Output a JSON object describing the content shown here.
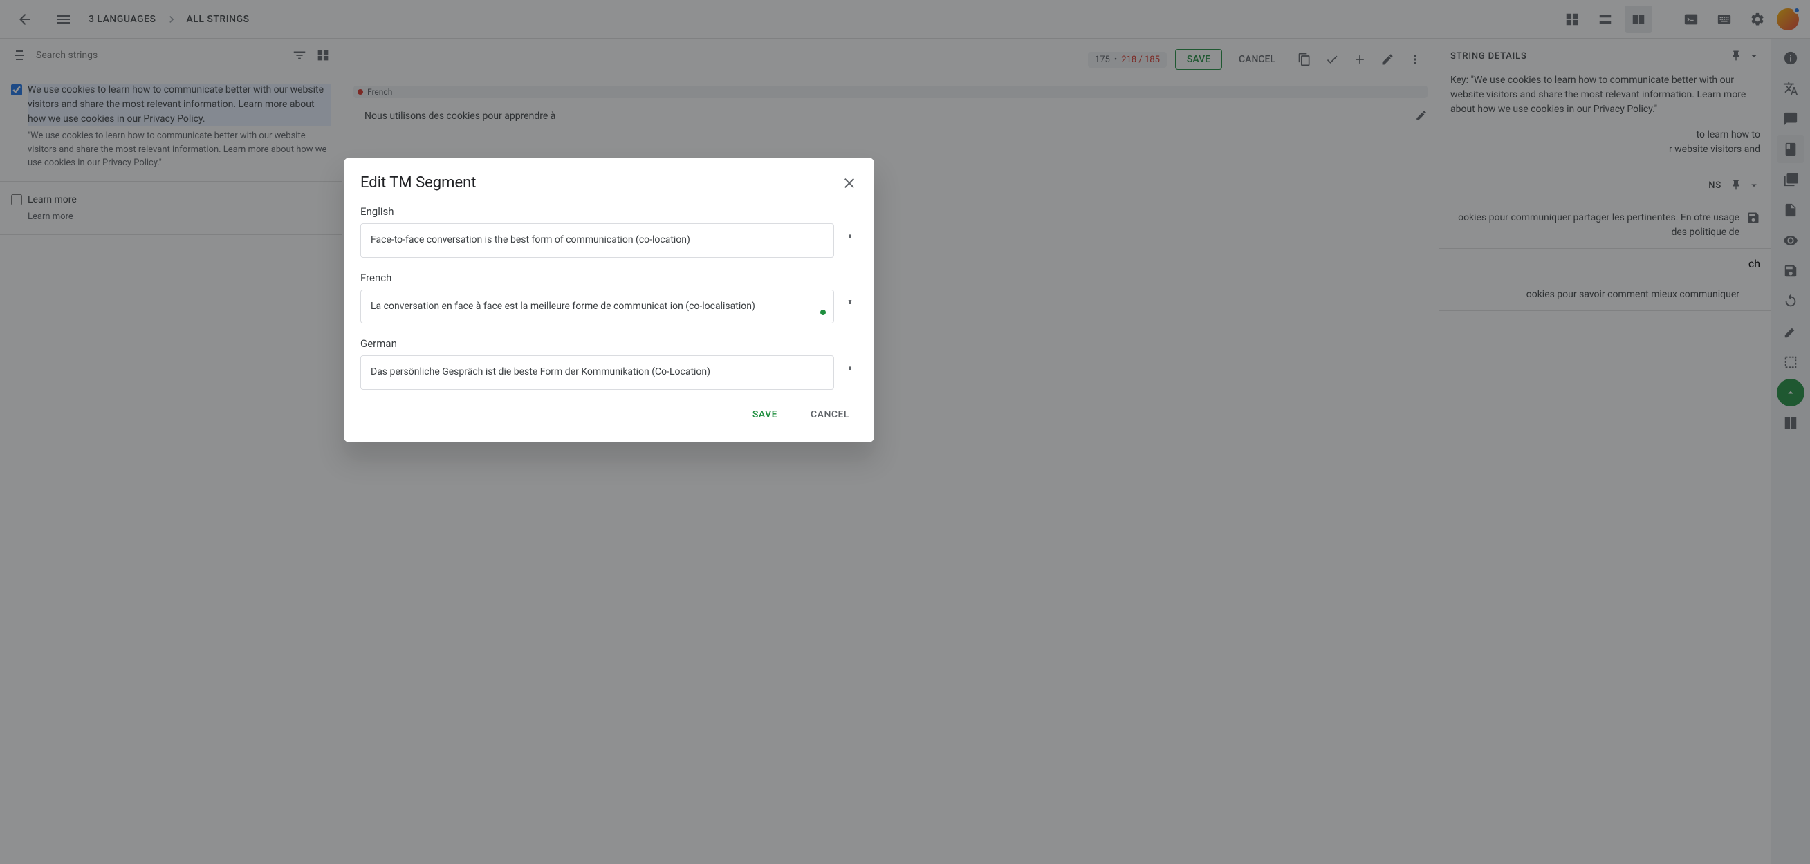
{
  "header": {
    "breadcrumb1": "3 LANGUAGES",
    "breadcrumb2": "ALL STRINGS"
  },
  "search": {
    "placeholder": "Search strings"
  },
  "editor": {
    "count1": "175",
    "count2": "218 / 185",
    "save": "SAVE",
    "cancel": "CANCEL",
    "lang_chip": "French",
    "translation": "Nous utilisons des cookies pour apprendre à"
  },
  "strings": [
    {
      "checked": true,
      "source": "We use cookies to learn how to communicate better with our website visitors and share the most relevant information. Learn more about how we use cookies in our Privacy Policy.",
      "quote": "\"We use cookies to learn how to communicate better with our website visitors and share the most relevant information. Learn more about how we use cookies in our Privacy Policy.\""
    },
    {
      "checked": false,
      "source": "Learn more",
      "quote": "Learn more"
    }
  ],
  "details": {
    "header": "STRING DETAILS",
    "key_label": "Key:",
    "key_value": "\"We use cookies to learn how to communicate better with our website visitors and share the most relevant information. Learn more about how we use cookies in our Privacy Policy.\"",
    "partial1": "to learn how to",
    "partial2": "r website visitors and"
  },
  "suggestions": {
    "header_suffix": "NS",
    "item1": "ookies pour communiquer partager les pertinentes. En otre usage des politique de",
    "lang_partial": "ch",
    "item2": "ookies pour savoir comment mieux communiquer"
  },
  "dialog": {
    "title": "Edit TM Segment",
    "save": "SAVE",
    "cancel": "CANCEL",
    "fields": [
      {
        "label": "English",
        "value": "Face-to-face conversation is the best form of communication (co-location)",
        "dot": false
      },
      {
        "label": "French",
        "value": "La conversation en face à face est la meilleure forme de communicat ion (co-localisation)",
        "dot": true
      },
      {
        "label": "German",
        "value": "Das persönliche Gespräch ist die beste Form der Kommunikation (Co-Location)",
        "dot": false
      }
    ]
  }
}
